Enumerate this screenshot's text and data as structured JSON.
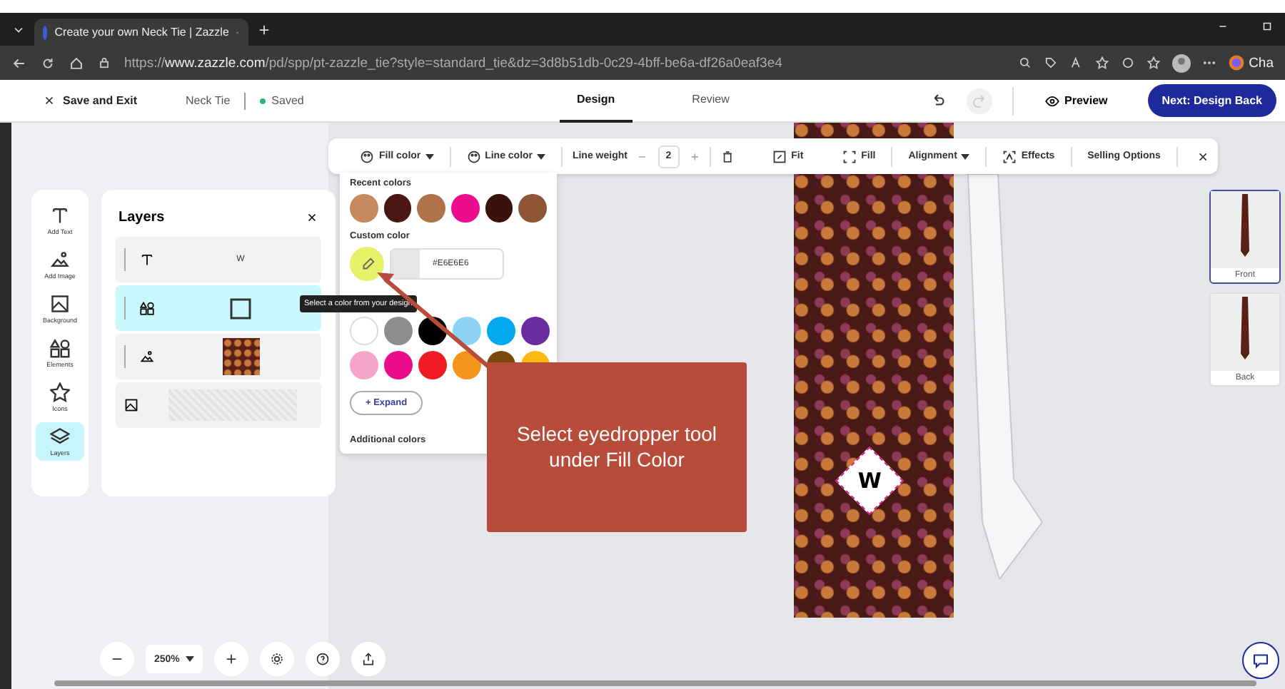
{
  "browser": {
    "tab_title": "Create your own Neck Tie | Zazzle",
    "url_prefix": "https://",
    "url_host": "www.zazzle.com",
    "url_path": "/pd/spp/pt-zazzle_tie?style=standard_tie&dz=3d8b51db-0c29-4bff-be6a-df26a0eaf3e4",
    "profile_label": "Cha"
  },
  "header": {
    "save_exit": "Save and Exit",
    "product": "Neck Tie",
    "status": "Saved",
    "tabs": [
      {
        "label": "Design",
        "selected": true
      },
      {
        "label": "Review",
        "selected": false
      }
    ],
    "preview": "Preview",
    "next": "Next: Design Back"
  },
  "sidebar": {
    "items": [
      {
        "label": "Add Text",
        "kind": "text",
        "selected": false
      },
      {
        "label": "Add Image",
        "kind": "image",
        "selected": false
      },
      {
        "label": "Background",
        "kind": "background",
        "selected": false
      },
      {
        "label": "Elements",
        "kind": "elements",
        "selected": false
      },
      {
        "label": "Icons",
        "kind": "icons",
        "selected": false
      },
      {
        "label": "Layers",
        "kind": "layers",
        "selected": true
      }
    ]
  },
  "layers": {
    "title": "Layers",
    "items": [
      {
        "kind": "text",
        "label": "W",
        "selected": false
      },
      {
        "kind": "shape",
        "selected": true
      },
      {
        "kind": "image",
        "selected": false
      },
      {
        "kind": "background",
        "selected": false
      }
    ]
  },
  "toolbar": {
    "fill_color": "Fill color",
    "line_color": "Line color",
    "line_weight": "Line weight",
    "line_weight_value": "2",
    "fit": "Fit",
    "fill": "Fill",
    "alignment": "Alignment",
    "effects": "Effects",
    "selling_options": "Selling Options"
  },
  "color_popup": {
    "recent_label": "Recent colors",
    "recent_colors": [
      {
        "color": "#c68a5e"
      },
      {
        "color": "#4a1613"
      },
      {
        "color": "#b07248"
      },
      {
        "color": "#ec0c8c"
      },
      {
        "color": "#3a120c"
      },
      {
        "color": "#8e5634"
      }
    ],
    "custom_label": "Custom color",
    "hex_value": "#E6E6E6",
    "tooltip": "Select a color from your design",
    "palette": [
      {
        "color": "#ffffff"
      },
      {
        "color": "#8c8c8c"
      },
      {
        "color": "#000000"
      },
      {
        "color": "#8ed3f5"
      },
      {
        "color": "#03a9ee"
      },
      {
        "color": "#6a2c9e"
      },
      {
        "color": "#f4a6c8"
      },
      {
        "color": "#ec0c8c"
      },
      {
        "color": "#ee1c25"
      },
      {
        "color": "#f7941d"
      },
      {
        "color": "#7a4a0c"
      },
      {
        "color": "#fdb913"
      }
    ],
    "expand": "+ Expand",
    "additional_label": "Additional colors"
  },
  "callout": {
    "text": "Select eyedropper tool under Fill Color"
  },
  "design": {
    "monogram": "W"
  },
  "views": [
    {
      "label": "Front",
      "selected": true
    },
    {
      "label": "Back",
      "selected": false
    }
  ],
  "zoom": {
    "value": "250%"
  }
}
